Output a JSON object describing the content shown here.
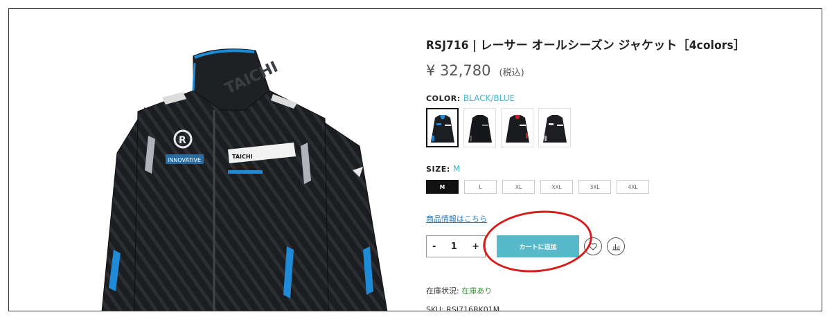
{
  "product": {
    "title": "RSJ716 | レーサー オールシーズン ジャケット［4colors］",
    "price": "¥ 32,780",
    "tax_note": "(税込)"
  },
  "color": {
    "label": "COLOR:",
    "selected": "BLACK/BLUE",
    "swatches": [
      {
        "name": "black-blue",
        "accent": "#1f8ad6",
        "selected": true
      },
      {
        "name": "black",
        "accent": "#555555",
        "selected": false
      },
      {
        "name": "black-red",
        "accent": "#c0202a",
        "selected": false
      },
      {
        "name": "black-white",
        "accent": "#e6e6e6",
        "selected": false
      }
    ]
  },
  "size": {
    "label": "SIZE:",
    "selected": "M",
    "options": [
      "M",
      "L",
      "XL",
      "XXL",
      "3XL",
      "4XL"
    ]
  },
  "product_info_link": "商品情報はこちら",
  "cart": {
    "minus": "-",
    "quantity": "1",
    "plus": "+",
    "add_to_cart": "カートに追加"
  },
  "stock": {
    "label": "在庫状況:",
    "value": "在庫あり"
  },
  "sku": {
    "label": "SKU:",
    "value": "RSJ716BK01M"
  },
  "colors": {
    "accent": "#57b9c9",
    "link": "#2a7ab8",
    "highlight_circle": "#d81b1b",
    "in_stock": "#3a8c3a"
  }
}
